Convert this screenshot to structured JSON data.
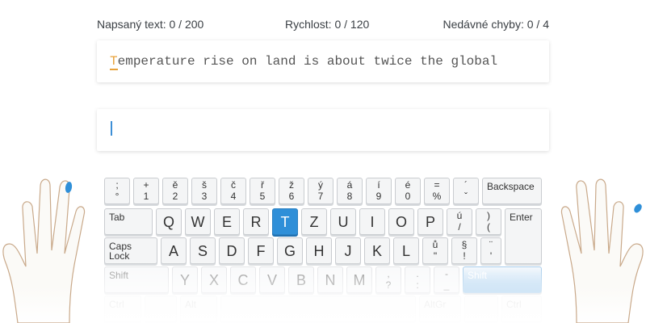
{
  "stats": {
    "typed": "Napsaný text: 0 / 200",
    "speed": "Rychlost: 0 / 120",
    "errors": "Nedávné chyby: 0 / 4"
  },
  "lesson": {
    "current_char": "T",
    "rest": "emperature rise on land is about twice the global"
  },
  "input": {
    "value": ""
  },
  "keyboard": {
    "row1": [
      {
        "top": ";",
        "bot": "°"
      },
      {
        "top": "+",
        "bot": "1"
      },
      {
        "top": "ě",
        "bot": "2"
      },
      {
        "top": "š",
        "bot": "3"
      },
      {
        "top": "č",
        "bot": "4"
      },
      {
        "top": "ř",
        "bot": "5"
      },
      {
        "top": "ž",
        "bot": "6"
      },
      {
        "top": "ý",
        "bot": "7"
      },
      {
        "top": "á",
        "bot": "8"
      },
      {
        "top": "í",
        "bot": "9"
      },
      {
        "top": "é",
        "bot": "0"
      },
      {
        "top": "=",
        "bot": "%"
      },
      {
        "top": "´",
        "bot": "ˇ"
      }
    ],
    "backspace": "Backspace",
    "tab": "Tab",
    "row2": [
      "Q",
      "W",
      "E",
      "R",
      "T",
      "Z",
      "U",
      "I",
      "O",
      "P"
    ],
    "row2_extra": [
      {
        "top": "ú",
        "bot": "/"
      },
      {
        "top": ")",
        "bot": "("
      }
    ],
    "enter": "Enter",
    "caps_line1": "Caps",
    "caps_line2": "Lock",
    "row3": [
      "A",
      "S",
      "D",
      "F",
      "G",
      "H",
      "J",
      "K",
      "L"
    ],
    "row3_extra": [
      {
        "top": "ů",
        "bot": "\""
      },
      {
        "top": "§",
        "bot": "!"
      },
      {
        "top": "¨",
        "bot": "'"
      }
    ],
    "shift_left": "Shift",
    "row4": [
      "Y",
      "X",
      "C",
      "V",
      "B",
      "N",
      "M"
    ],
    "row4_extra": [
      {
        "top": ",",
        "bot": "?"
      },
      {
        "top": ".",
        "bot": ":"
      },
      {
        "top": "-",
        "bot": "_"
      }
    ],
    "shift_right": "Shift",
    "ctrl_left": "Ctrl",
    "alt_left": "Alt",
    "altgr": "AltGr",
    "ctrl_right": "Ctrl",
    "active_key": "T",
    "active_color": "#2f8fd8"
  },
  "hands": {
    "left_icon": "left-hand-icon",
    "right_icon": "right-hand-icon",
    "finger_highlight_color": "#2f8fd8"
  }
}
